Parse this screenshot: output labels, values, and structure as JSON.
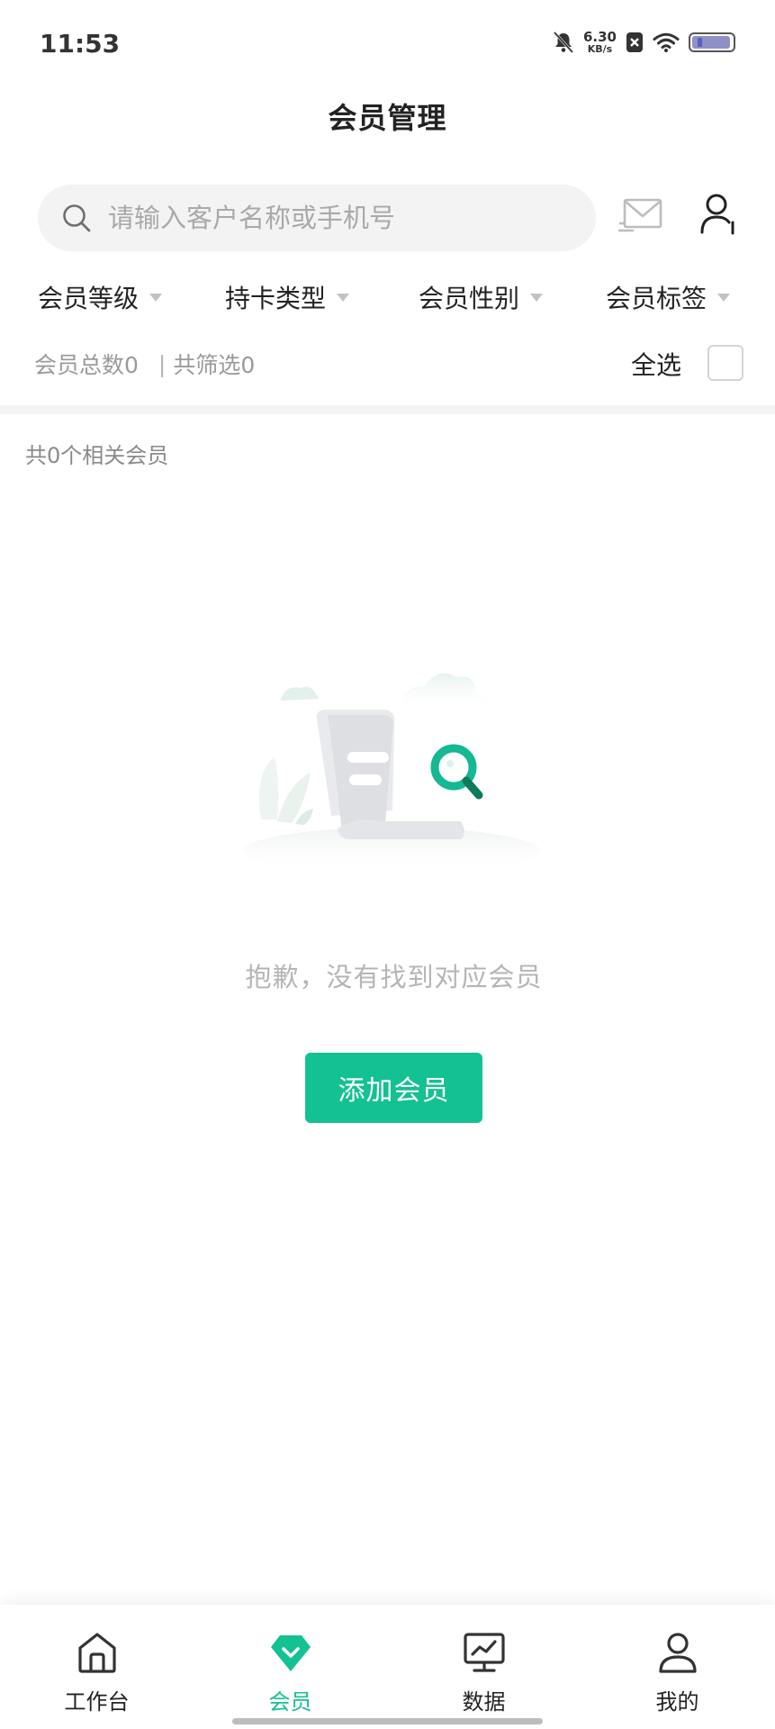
{
  "status_bar": {
    "time": "11:53",
    "network_speed_value": "6.30",
    "network_speed_unit": "KB/s",
    "icons": [
      "bell-muted-icon",
      "sim-blocked-icon",
      "wifi-icon",
      "battery-icon"
    ]
  },
  "header": {
    "title": "会员管理"
  },
  "search": {
    "placeholder": "请输入客户名称或手机号",
    "value": ""
  },
  "filters": [
    {
      "label": "会员等级"
    },
    {
      "label": "持卡类型"
    },
    {
      "label": "会员性别"
    },
    {
      "label": "会员标签"
    }
  ],
  "summary": {
    "total_label": "会员总数0",
    "separator": "|",
    "filtered_label": "共筛选0",
    "select_all_label": "全选"
  },
  "list": {
    "related_count_label": "共0个相关会员",
    "empty_text": "抱歉，没有找到对应会员",
    "add_button_label": "添加会员"
  },
  "tab_bar": {
    "tabs": [
      {
        "label": "工作台",
        "icon": "home-icon"
      },
      {
        "label": "会员",
        "icon": "diamond-icon",
        "active": true
      },
      {
        "label": "数据",
        "icon": "monitor-chart-icon"
      },
      {
        "label": "我的",
        "icon": "person-icon"
      }
    ]
  },
  "colors": {
    "accent": "#13c192",
    "muted_text": "#9a9a9a",
    "background": "#ffffff"
  }
}
